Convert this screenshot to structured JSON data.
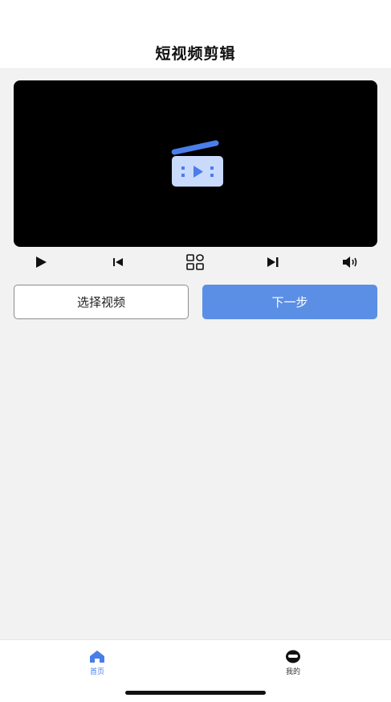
{
  "header": {
    "title": "短视频剪辑"
  },
  "player": {
    "accent_color": "#4a7ee8",
    "icon": "clapperboard-icon"
  },
  "controls": {
    "play_icon": "play-icon",
    "prev_icon": "skip-previous-icon",
    "grid_icon": "grid-icon",
    "next_icon": "skip-next-icon",
    "volume_icon": "volume-icon"
  },
  "actions": {
    "select_label": "选择视频",
    "next_label": "下一步",
    "next_color": "#5b8fe6"
  },
  "tabbar": {
    "tabs": [
      {
        "label": "首页",
        "icon": "home-icon",
        "active": true
      },
      {
        "label": "我的",
        "icon": "profile-icon",
        "active": false
      }
    ],
    "active_color": "#4a7ee8"
  }
}
